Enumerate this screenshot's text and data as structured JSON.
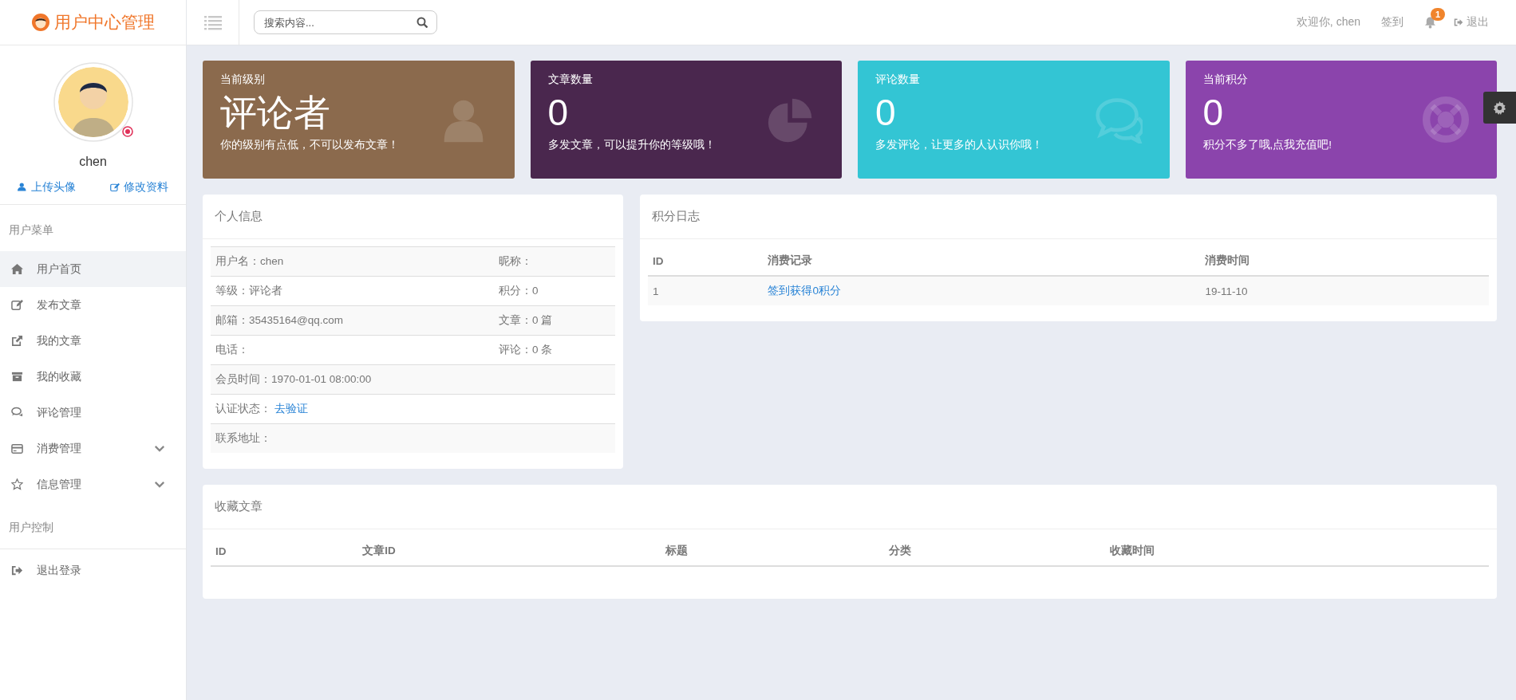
{
  "brand": {
    "title": "用户中心管理"
  },
  "header": {
    "search": {
      "placeholder": "搜索内容..."
    },
    "welcome": "欢迎你, chen",
    "sign_in": "签到",
    "notifications": {
      "badge": "1"
    },
    "logout": "退出"
  },
  "profile": {
    "name": "chen",
    "actions": [
      "上传头像",
      "修改资料"
    ]
  },
  "sidebar": {
    "sections": [
      {
        "title": "用户菜单",
        "items": [
          {
            "label": "用户首页",
            "selected": true
          },
          {
            "label": "发布文章",
            "selected": false
          },
          {
            "label": "我的文章",
            "selected": false
          },
          {
            "label": "我的收藏",
            "selected": false
          },
          {
            "label": "评论管理",
            "selected": false
          },
          {
            "label": "消费管理",
            "selected": false,
            "expanded": false
          },
          {
            "label": "信息管理",
            "selected": false,
            "expanded": false
          }
        ]
      },
      {
        "title": "用户控制",
        "items": [
          {
            "label": "退出登录",
            "selected": false
          }
        ]
      }
    ]
  },
  "stat_cards": [
    {
      "title": "当前级别",
      "value": "评论者",
      "note": "你的级别有点低，不可以发布文章！",
      "color": "#8b6a4d"
    },
    {
      "title": "文章数量",
      "value": "0",
      "note": "多发文章，可以提升你的等级哦！",
      "color": "#4a274e"
    },
    {
      "title": "评论数量",
      "value": "0",
      "note": "多发评论，让更多的人认识你哦！",
      "color": "#33c5d4"
    },
    {
      "title": "当前积分",
      "value": "0",
      "note": "积分不多了哦,点我充值吧!",
      "color": "#8b44ac"
    }
  ],
  "personal_info": {
    "title": "个人信息",
    "rows": [
      [
        {
          "label": "用户名：",
          "value": "chen"
        },
        {
          "label": "昵称："
        }
      ],
      [
        {
          "label": "等级：",
          "value": "评论者"
        },
        {
          "label": "积分：",
          "value": "0"
        }
      ],
      [
        {
          "label": "邮箱：",
          "value": "35435164@qq.com"
        },
        {
          "label": "文章：",
          "value": "0 篇"
        }
      ],
      [
        {
          "label": "电话："
        },
        {
          "label": "评论：",
          "value": "0 条"
        }
      ],
      [
        {
          "label": "会员时间：",
          "value": "1970-01-01 08:00:00"
        }
      ],
      [
        {
          "label": "认证状态：",
          "link": "去验证"
        }
      ],
      [
        {
          "label": "联系地址："
        }
      ]
    ]
  },
  "points_log": {
    "title": "积分日志",
    "columns": [
      "ID",
      "消费记录",
      "消费时间"
    ],
    "rows": [
      [
        "1",
        "签到获得0积分",
        "19-11-10"
      ]
    ]
  },
  "favorites": {
    "title": "收藏文章",
    "columns": [
      "ID",
      "文章ID",
      "标题",
      "分类",
      "收藏时间"
    ]
  }
}
